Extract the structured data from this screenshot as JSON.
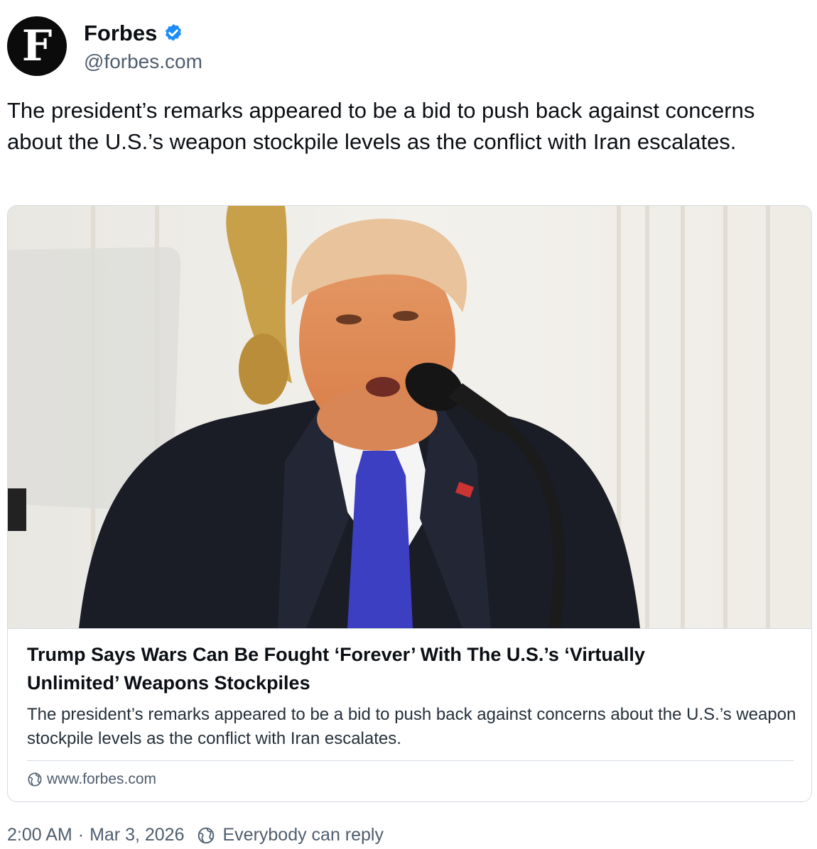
{
  "author": {
    "avatar_letter": "F",
    "name": "Forbes",
    "handle": "@forbes.com",
    "verified_icon": "verified-badge-icon",
    "verified_color": "#1d8cf8"
  },
  "post": {
    "text": "The president’s remarks appeared to be a bid to push back against concerns about the U.S.’s weapon stockpile levels as the conflict with Iran escalates."
  },
  "link_card": {
    "image_icon": "photo-of-speaker-at-podium",
    "title": "Trump Says Wars Can Be Fought ‘Forever’ With The U.S.’s ‘Virtually Unlimited’ Weapons Stockpiles",
    "description": "The president’s remarks appeared to be a bid to push back against concerns about the U.S.’s weapon stockpile levels as the conflict with Iran escalates.",
    "domain_icon": "globe-icon",
    "domain": "www.forbes.com"
  },
  "footer": {
    "time": "2:00 AM",
    "separator": "·",
    "date": "Mar 3, 2026",
    "reply_icon": "globe-icon",
    "reply_setting": "Everybody can reply"
  }
}
